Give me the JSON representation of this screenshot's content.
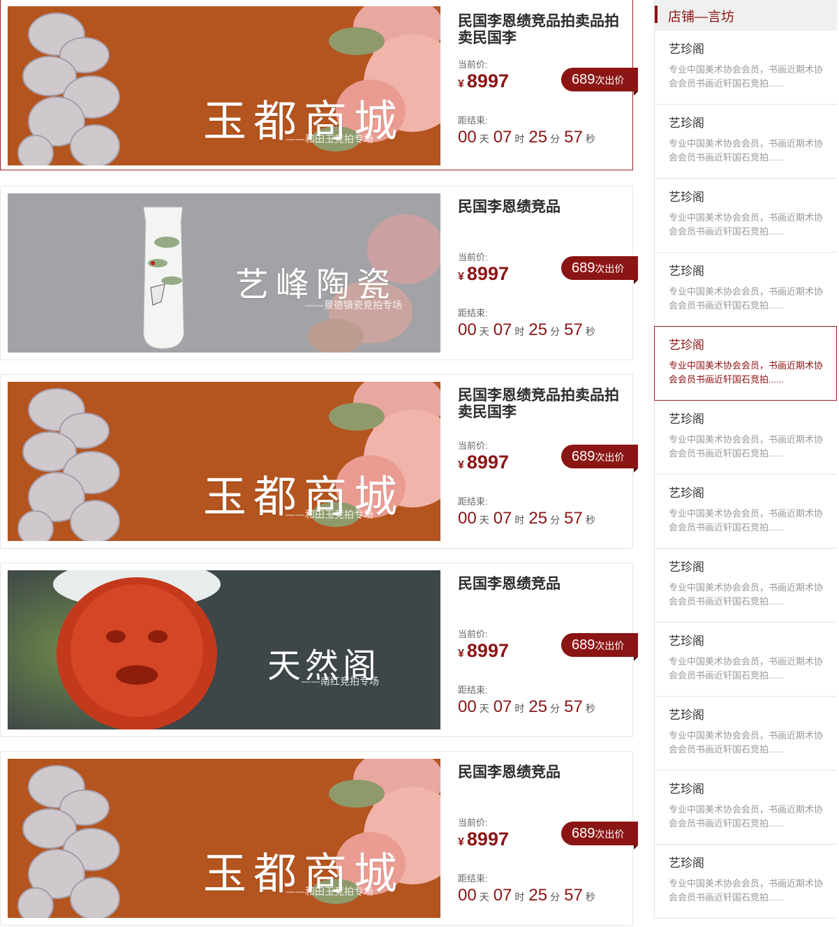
{
  "auctions": [
    {
      "banner_title": "玉都商城",
      "banner_sub": "——和田玉竞拍专场",
      "title": "民国李恩绩竞品拍卖品拍卖民国李",
      "price_label": "当前价:",
      "currency": "¥",
      "price": "8997",
      "bid_count": "689",
      "bid_suffix": "次出价",
      "countdown_label": "距结束:",
      "days": "00",
      "days_unit": "天",
      "hours": "07",
      "hours_unit": "时",
      "minutes": "25",
      "minutes_unit": "分",
      "seconds": "57",
      "seconds_unit": "秒"
    },
    {
      "banner_title": "艺峰陶瓷",
      "banner_sub": "——景德镇瓷竞拍专场",
      "title": "民国李恩绩竞品",
      "price_label": "当前价:",
      "currency": "¥",
      "price": "8997",
      "bid_count": "689",
      "bid_suffix": "次出价",
      "countdown_label": "距结束:",
      "days": "00",
      "days_unit": "天",
      "hours": "07",
      "hours_unit": "时",
      "minutes": "25",
      "minutes_unit": "分",
      "seconds": "57",
      "seconds_unit": "秒"
    },
    {
      "banner_title": "玉都商城",
      "banner_sub": "——和田玉竞拍专场",
      "title": "民国李恩绩竞品拍卖品拍卖民国李",
      "price_label": "当前价:",
      "currency": "¥",
      "price": "8997",
      "bid_count": "689",
      "bid_suffix": "次出价",
      "countdown_label": "距结束:",
      "days": "00",
      "days_unit": "天",
      "hours": "07",
      "hours_unit": "时",
      "minutes": "25",
      "minutes_unit": "分",
      "seconds": "57",
      "seconds_unit": "秒"
    },
    {
      "banner_title": "天然阁",
      "banner_sub": "——南红竞拍专场",
      "title": "民国李恩绩竞品",
      "price_label": "当前价:",
      "currency": "¥",
      "price": "8997",
      "bid_count": "689",
      "bid_suffix": "次出价",
      "countdown_label": "距结束:",
      "days": "00",
      "days_unit": "天",
      "hours": "07",
      "hours_unit": "时",
      "minutes": "25",
      "minutes_unit": "分",
      "seconds": "57",
      "seconds_unit": "秒"
    },
    {
      "banner_title": "玉都商城",
      "banner_sub": "——和田玉竞拍专场",
      "title": "民国李恩绩竞品",
      "price_label": "当前价:",
      "currency": "¥",
      "price": "8997",
      "bid_count": "689",
      "bid_suffix": "次出价",
      "countdown_label": "距结束:",
      "days": "00",
      "days_unit": "天",
      "hours": "07",
      "hours_unit": "时",
      "minutes": "25",
      "minutes_unit": "分",
      "seconds": "57",
      "seconds_unit": "秒"
    }
  ],
  "sidebar": {
    "title": "店铺—言坊",
    "shops": [
      {
        "name": "艺珍阁",
        "desc": "专业中国美术协会会员，书画近期术协会会员书画近轩国石竞拍......"
      },
      {
        "name": "艺珍阁",
        "desc": "专业中国美术协会会员，书画近期术协会会员书画近轩国石竞拍......"
      },
      {
        "name": "艺珍阁",
        "desc": "专业中国美术协会会员，书画近期术协会会员书画近轩国石竞拍......"
      },
      {
        "name": "艺珍阁",
        "desc": "专业中国美术协会会员，书画近期术协会会员书画近轩国石竞拍......"
      },
      {
        "name": "艺珍阁",
        "desc": "专业中国美术协会会员，书画近期术协会会员书画近轩国石竞拍......"
      },
      {
        "name": "艺珍阁",
        "desc": "专业中国美术协会会员，书画近期术协会会员书画近轩国石竞拍......"
      },
      {
        "name": "艺珍阁",
        "desc": "专业中国美术协会会员，书画近期术协会会员书画近轩国石竞拍......"
      },
      {
        "name": "艺珍阁",
        "desc": "专业中国美术协会会员，书画近期术协会会员书画近轩国石竞拍......"
      },
      {
        "name": "艺珍阁",
        "desc": "专业中国美术协会会员，书画近期术协会会员书画近轩国石竞拍......"
      },
      {
        "name": "艺珍阁",
        "desc": "专业中国美术协会会员，书画近期术协会会员书画近轩国石竞拍......"
      },
      {
        "name": "艺珍阁",
        "desc": "专业中国美术协会会员，书画近期术协会会员书画近轩国石竞拍......"
      },
      {
        "name": "艺珍阁",
        "desc": "专业中国美术协会会员，书画近期术协会会员书画近轩国石竞拍......"
      }
    ]
  },
  "colors": {
    "accent": "#8b1414",
    "jade_banner_bg": "#b4541f",
    "porcelain_banner_bg": "#a3a3a7",
    "coral_banner_bg": "#3d4648"
  }
}
